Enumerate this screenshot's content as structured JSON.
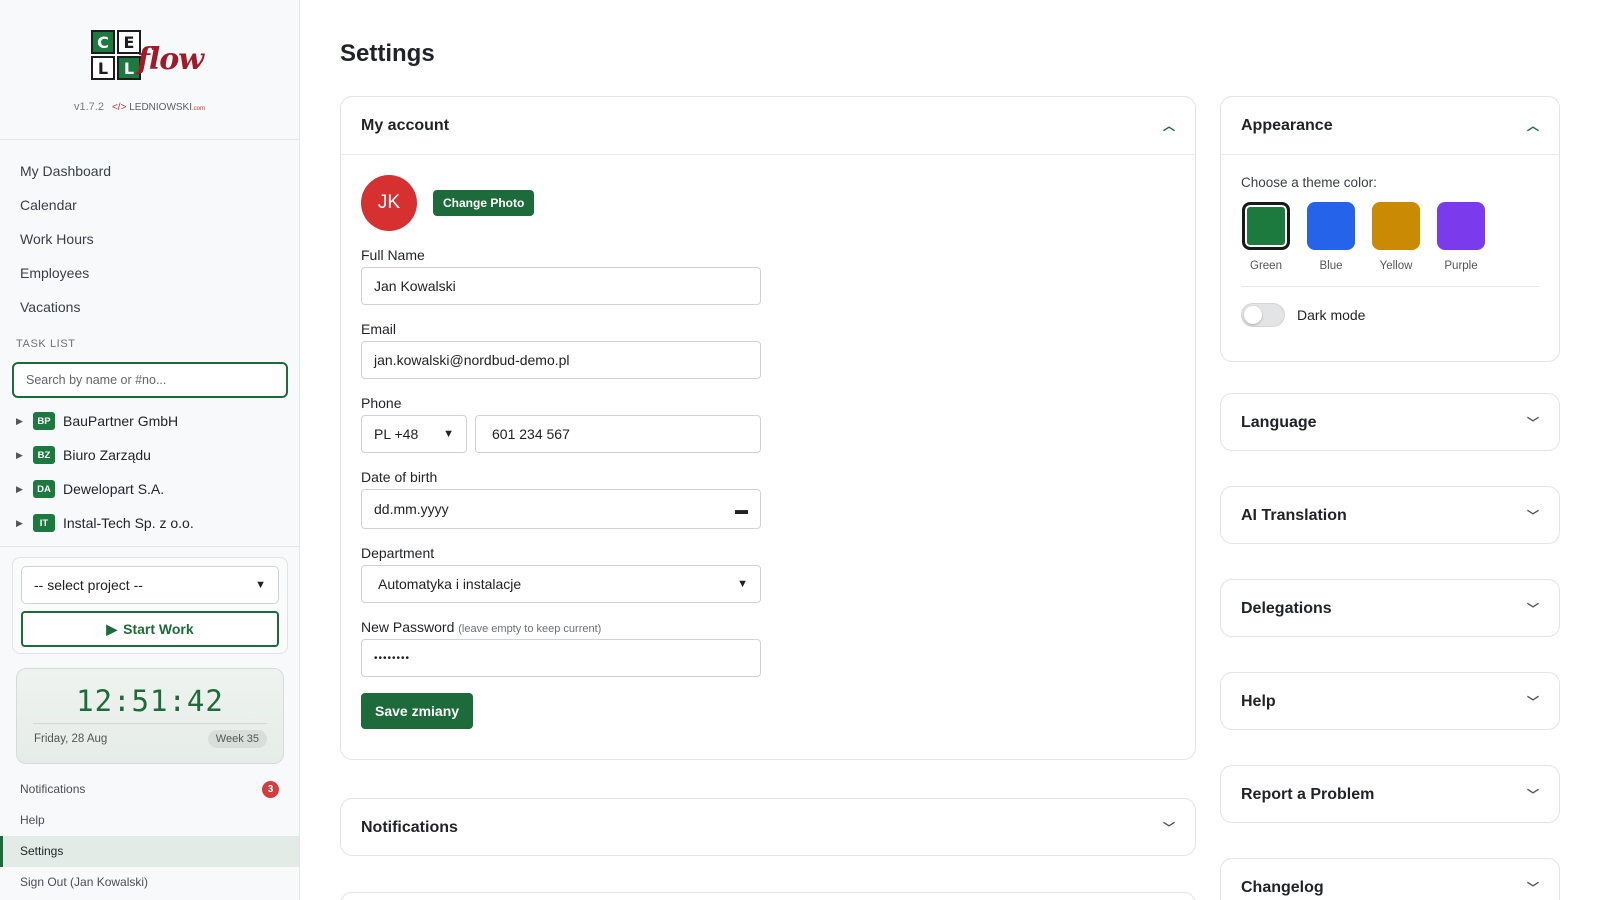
{
  "sidebar": {
    "logo": {
      "letters": [
        "C",
        "E",
        "L",
        "L"
      ],
      "word": "flow"
    },
    "version": "v1.7.2",
    "author": {
      "tag": "</>",
      "name": "LEDNIOWSKI",
      "domain": ".com"
    },
    "nav": [
      "My Dashboard",
      "Calendar",
      "Work Hours",
      "Employees",
      "Vacations"
    ],
    "task_list_label": "TASK LIST",
    "search_placeholder": "Search by name or #no...",
    "tasks": [
      {
        "code": "BP",
        "name": "BauPartner GmbH"
      },
      {
        "code": "BZ",
        "name": "Biuro Zarządu"
      },
      {
        "code": "DA",
        "name": "Dewelopart S.A."
      },
      {
        "code": "IT",
        "name": "Instal-Tech Sp. z o.o."
      }
    ],
    "project_select": "-- select project --",
    "start_work": "Start Work",
    "clock": {
      "time": "12:51:42",
      "date": "Friday, 28 Aug",
      "week": "Week 35"
    },
    "bottom_nav": {
      "notifications": "Notifications",
      "notifications_count": "3",
      "help": "Help",
      "settings": "Settings",
      "sign_out": "Sign Out (Jan Kowalski)"
    }
  },
  "main": {
    "title": "Settings",
    "account": {
      "header": "My account",
      "initials": "JK",
      "change_photo": "Change Photo",
      "full_name_label": "Full Name",
      "full_name": "Jan Kowalski",
      "email_label": "Email",
      "email": "jan.kowalski@nordbud-demo.pl",
      "phone_label": "Phone",
      "phone_code": "PL +48",
      "phone_number": "601 234 567",
      "dob_label": "Date of birth",
      "dob_placeholder": "dd.mm.yyyy",
      "department_label": "Department",
      "department": "Automatyka i instalacje",
      "password_label": "New Password",
      "password_hint": "(leave empty to keep current)",
      "password_mask": "••••••••",
      "save": "Save zmiany"
    },
    "notifications_header": "Notifications"
  },
  "right": {
    "appearance": {
      "header": "Appearance",
      "choose_label": "Choose a theme color:",
      "themes": [
        {
          "name": "Green",
          "color": "#1d7a3f",
          "selected": true
        },
        {
          "name": "Blue",
          "color": "#2563eb",
          "selected": false
        },
        {
          "name": "Yellow",
          "color": "#ca8a04",
          "selected": false
        },
        {
          "name": "Purple",
          "color": "#7c3aed",
          "selected": false
        }
      ],
      "dark_mode": "Dark mode",
      "dark_mode_on": false
    },
    "sections": [
      "Language",
      "AI Translation",
      "Delegations",
      "Help",
      "Report a Problem",
      "Changelog"
    ]
  },
  "colors": {
    "accent": "#1d6b3a",
    "avatar": "#d63030",
    "badge_red": "#d63c3c"
  }
}
